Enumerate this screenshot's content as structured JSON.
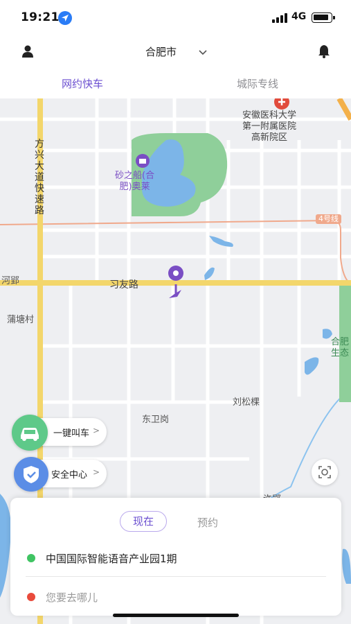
{
  "status_bar": {
    "time": "19:21",
    "network": "4G"
  },
  "header": {
    "city": "合肥市"
  },
  "tabs": [
    {
      "label": "网约快车",
      "active": true
    },
    {
      "label": "城际专线",
      "active": false
    }
  ],
  "map": {
    "labels": {
      "hospital": [
        "安徽医科大学",
        "第一附属医院",
        "高新院区"
      ],
      "poi": [
        "砂之船(合",
        "肥)奥莱"
      ],
      "expressway": [
        "方",
        "兴",
        "大",
        "道",
        "快",
        "速",
        "路"
      ],
      "road_badge": "4号线",
      "xiyou_road": "习友路",
      "he_ying": "河郢",
      "putang": "蒲塘村",
      "hefei_eco": [
        "合肥",
        "生态"
      ],
      "liusong": "刘松棵",
      "dongweigang": "东卫岗",
      "xuying": "许郢"
    }
  },
  "actions": {
    "one_click": "一键叫车",
    "safety": "安全中心",
    "arrow": ">"
  },
  "booking": {
    "now": "现在",
    "later": "预约",
    "from": "中国国际智能语音产业园1期",
    "to_placeholder": "您要去哪儿"
  },
  "colors": {
    "accent": "#6b4fd0",
    "start_dot": "#40c463",
    "end_dot": "#e94b3c",
    "park_green": "#8fcf9a",
    "lake_blue": "#7cb5e8",
    "expressway": "#f3d66b"
  }
}
